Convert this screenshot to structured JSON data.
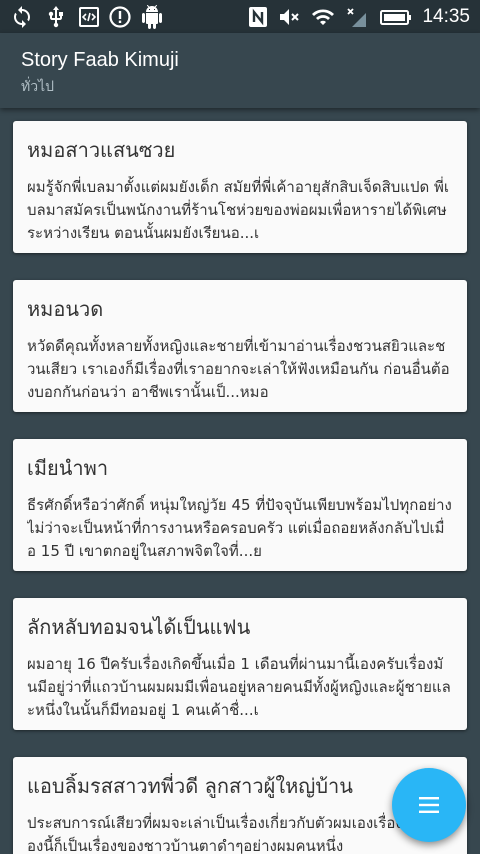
{
  "status_bar": {
    "time": "14:35",
    "icons": [
      "sync-icon",
      "usb-icon",
      "developer-code-icon",
      "alert-icon",
      "android-icon",
      "nfc-icon",
      "mute-icon",
      "wifi-icon",
      "no-signal-icon",
      "battery-icon"
    ]
  },
  "app_bar": {
    "title": "Story Faab Kimuji",
    "subtitle": "ทั่วไป"
  },
  "stories": [
    {
      "title": "หมอสาวแสนซวย",
      "excerpt": "ผมรู้จักพี่เบลมาตั้งแต่ผมยังเด็ก สมัยที่พี่เค้าอายุสักสิบเจ็ดสิบแปด พี่เบลมาสมัครเป็นพนักงานที่ร้านโชห่วยของพ่อผมเพื่อหารายได้พิเศษระหว่างเรียน ตอนนั้นผมยังเรียนอ...เ"
    },
    {
      "title": "หมอนวด",
      "excerpt": "หวัดดีคุณทั้งหลายทั้งหญิงและชายที่เข้ามาอ่านเรื่องชวนสยิวและชวนเสียว เราเองก็มีเรื่องที่เราอยากจะเล่าให้ฟังเหมือนกัน ก่อนอื่นต้องบอกกันก่อนว่า อาชีพเรานั้นเป็...หมอ"
    },
    {
      "title": "เมียนำพา",
      "excerpt": "ธีรศักดิ์หรือว่าศักดิ์ หนุ่มใหญ่วัย 45 ที่ปัจจุบันเพียบพร้อมไปทุกอย่าง ไม่ว่าจะเป็นหน้าที่การงานหรือครอบครัว แต่เมื่อถอยหลังกลับไปเมื่อ 15 ปี เขาตกอยู่ในสภาพจิตใจที่...ย"
    },
    {
      "title": "ลักหลับทอมจนได้เป็นแฟน",
      "excerpt": "ผมอายุ 16 ปีครับเรื่องเกิดขึ้นเมื่อ 1 เดือนที่ผ่านมานี้เองครับเรื่องมันมีอยู่ว่าที่แถวบ้านผมผมมีเพื่อนอยู่หลายคนมีทั้งผู้หญิงและผู้ชายและหนึ่งในนั้นก็มีทอมอยู่ 1 คนเค้าชื่...เ"
    },
    {
      "title": "แอบลิ้มรสสาวทพี่วดี ลูกสาวผู้ใหญ่บ้าน",
      "excerpt": "ประสบการณ์เสียวที่ผมจะเล่าเป็นเรื่องเกี่ยวกับตัวผมเองเรื่องเสียวเรื่องนี้ก็เป็นเรื่องของชาวบ้านตาดำๆอย่างผมคนหนึ่ง"
    }
  ],
  "fab": {
    "icon": "menu-icon",
    "color": "#29b6f6"
  },
  "colors": {
    "background": "#37474f",
    "status_bar": "#263238",
    "card": "#fafafa",
    "accent": "#29b6f6"
  }
}
